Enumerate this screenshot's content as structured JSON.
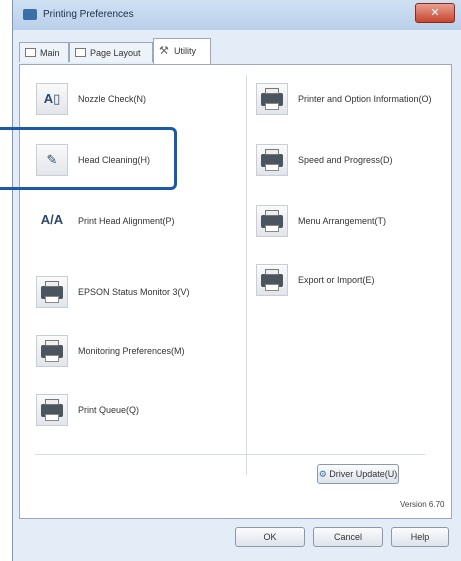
{
  "window": {
    "title": "Printing Preferences",
    "close_glyph": "✕"
  },
  "tabs": [
    {
      "label": "Main",
      "icon": "main-tab-icon"
    },
    {
      "label": "Page Layout",
      "icon": "page-layout-tab-icon"
    },
    {
      "label": "Utility",
      "icon": "utility-tab-icon",
      "active": true
    }
  ],
  "left_items": [
    {
      "label": "Nozzle Check(N)",
      "icon": "nozzle-check-icon",
      "glyph": "A▯"
    },
    {
      "label": "Head Cleaning(H)",
      "icon": "head-cleaning-icon",
      "glyph": "✎"
    },
    {
      "label": "Print Head Alignment(P)",
      "icon": "print-head-alignment-icon",
      "glyph": "A/A"
    },
    {
      "label": "EPSON Status Monitor 3(V)",
      "icon": "status-monitor-icon"
    },
    {
      "label": "Monitoring Preferences(M)",
      "icon": "monitoring-preferences-icon"
    },
    {
      "label": "Print Queue(Q)",
      "icon": "print-queue-icon"
    }
  ],
  "right_items": [
    {
      "label": "Printer and Option Information(O)",
      "icon": "printer-option-info-icon"
    },
    {
      "label": "Speed and Progress(D)",
      "icon": "speed-progress-icon"
    },
    {
      "label": "Menu Arrangement(T)",
      "icon": "menu-arrangement-icon"
    },
    {
      "label": "Export or Import(E)",
      "icon": "export-import-icon"
    }
  ],
  "driver_update_label": "Driver Update(U)",
  "version_text": "Version 6.70",
  "buttons": {
    "ok": "OK",
    "cancel": "Cancel",
    "help": "Help"
  },
  "colors": {
    "highlight": "#1a5aa8",
    "window_bg": "#e4edf7"
  }
}
